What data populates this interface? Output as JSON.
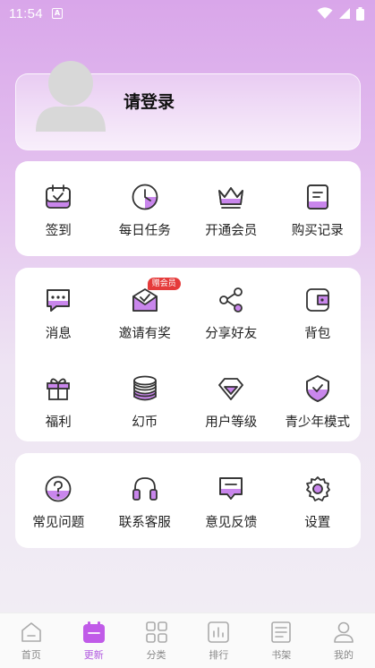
{
  "status": {
    "time": "11:54",
    "app_icon": "A"
  },
  "login": {
    "title": "请登录"
  },
  "quick": [
    {
      "label": "签到",
      "icon": "checkin-icon"
    },
    {
      "label": "每日任务",
      "icon": "clock-icon"
    },
    {
      "label": "开通会员",
      "icon": "crown-icon"
    },
    {
      "label": "购买记录",
      "icon": "document-icon"
    }
  ],
  "services": [
    {
      "label": "消息",
      "icon": "message-icon"
    },
    {
      "label": "邀请有奖",
      "icon": "invite-icon",
      "badge": "赠会员"
    },
    {
      "label": "分享好友",
      "icon": "share-icon"
    },
    {
      "label": "背包",
      "icon": "wallet-icon"
    },
    {
      "label": "福利",
      "icon": "gift-icon"
    },
    {
      "label": "幻币",
      "icon": "coins-icon"
    },
    {
      "label": "用户等级",
      "icon": "diamond-icon"
    },
    {
      "label": "青少年模式",
      "icon": "shield-icon"
    }
  ],
  "help": [
    {
      "label": "常见问题",
      "icon": "question-icon"
    },
    {
      "label": "联系客服",
      "icon": "headset-icon"
    },
    {
      "label": "意见反馈",
      "icon": "feedback-icon"
    },
    {
      "label": "设置",
      "icon": "gear-icon"
    }
  ],
  "tabs": [
    {
      "label": "首页",
      "icon": "home-icon"
    },
    {
      "label": "更新",
      "icon": "calendar-icon",
      "active": true
    },
    {
      "label": "分类",
      "icon": "category-icon"
    },
    {
      "label": "排行",
      "icon": "ranking-icon"
    },
    {
      "label": "书架",
      "icon": "bookshelf-icon"
    },
    {
      "label": "我的",
      "icon": "profile-icon"
    }
  ],
  "colors": {
    "accent": "#b15adf",
    "icon_stroke": "#333333",
    "badge": "#e53b3b"
  }
}
